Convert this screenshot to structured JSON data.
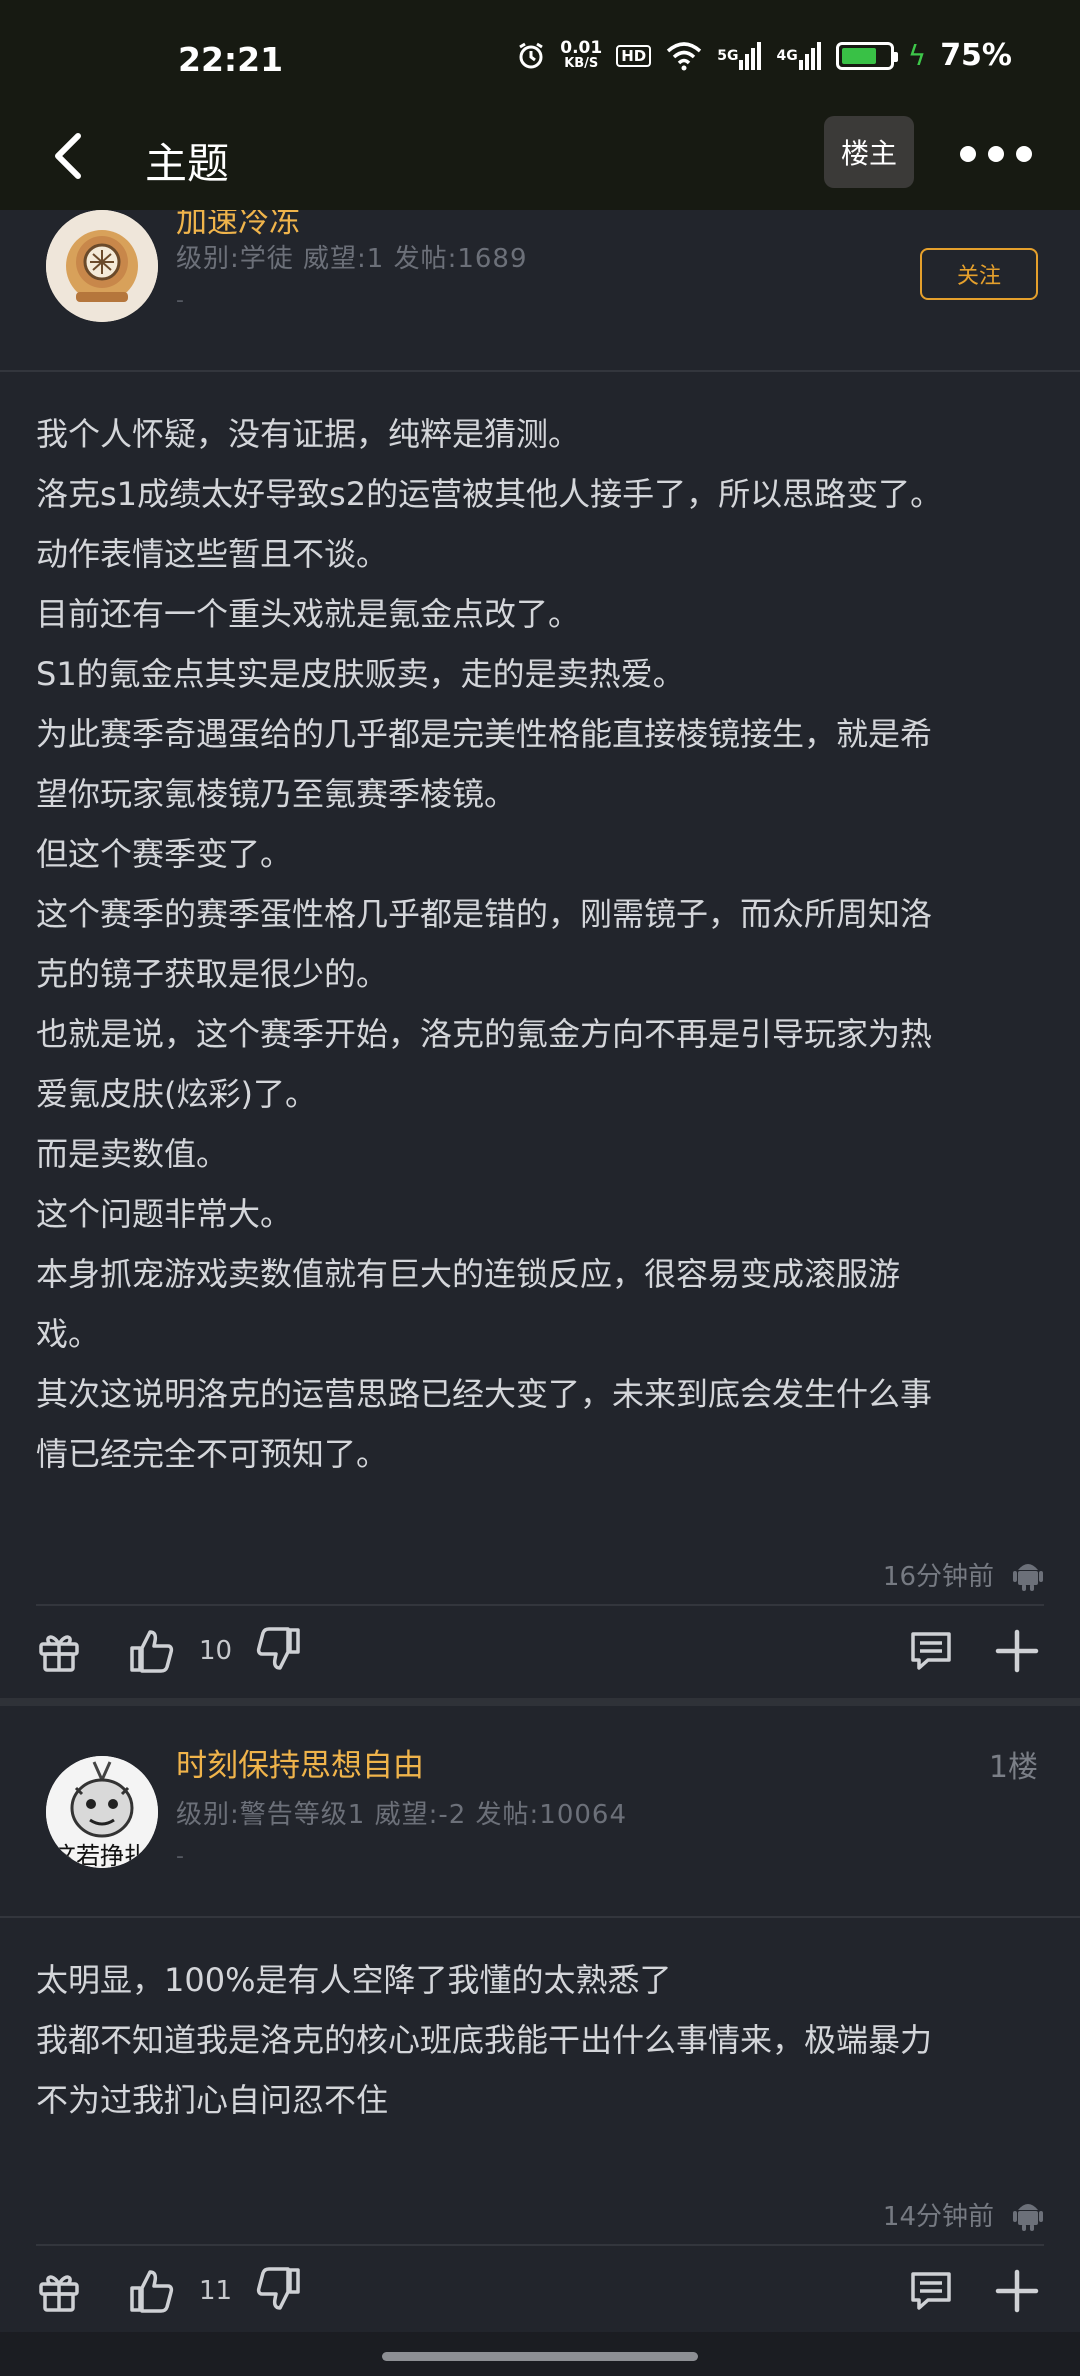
{
  "status_bar": {
    "time": "22:21",
    "net_speed": "0.01",
    "net_unit": "KB/S",
    "hd": "HD",
    "sig1": "5G",
    "sig2": "4G",
    "battery_percent": "75%",
    "battery_level": 0.75,
    "battery_color": "#39c146"
  },
  "header": {
    "back_icon": "chevron-left-icon",
    "title": "主题",
    "owner_button": "楼主",
    "more_icon": "more-horizontal-icon"
  },
  "posts": [
    {
      "username": "加速冷冻",
      "stats": "级别:学徒 威望:1 发帖:1689",
      "signature": "-",
      "follow_label": "关注",
      "body": "我个人怀疑，没有证据，纯粹是猜测。\n洛克s1成绩太好导致s2的运营被其他人接手了，所以思路变了。\n动作表情这些暂且不谈。\n目前还有一个重头戏就是氪金点改了。\nS1的氪金点其实是皮肤贩卖，走的是卖热爱。\n为此赛季奇遇蛋给的几乎都是完美性格能直接棱镜接生，就是希\n望你玩家氪棱镜乃至氪赛季棱镜。\n但这个赛季变了。\n这个赛季的赛季蛋性格几乎都是错的，刚需镜子，而众所周知洛\n克的镜子获取是很少的。\n也就是说，这个赛季开始，洛克的氪金方向不再是引导玩家为热\n爱氪皮肤(炫彩)了。\n而是卖数值。\n这个问题非常大。\n本身抓宠游戏卖数值就有巨大的连锁反应，很容易变成滚服游\n戏。\n其次这说明洛克的运营思路已经大变了，未来到底会发生什么事\n情已经完全不可预知了。",
      "time_ago": "16分钟前",
      "likes": "10"
    },
    {
      "username": "时刻保持思想自由",
      "stats": "级别:警告等级1 威望:-2 发帖:10064",
      "signature": "-",
      "floor": "1楼",
      "avatar_text": "这若挣扎",
      "body": "太明显，100%是有人空降了我懂的太熟悉了\n我都不知道我是洛克的核心班底我能干出什么事情来，极端暴力\n不为过我扪心自问忍不住",
      "time_ago": "14分钟前",
      "likes": "11"
    }
  ],
  "colors": {
    "accent": "#e5a02c",
    "username": "#f0b44b",
    "background": "#22252c",
    "header_bg": "#171a12"
  }
}
